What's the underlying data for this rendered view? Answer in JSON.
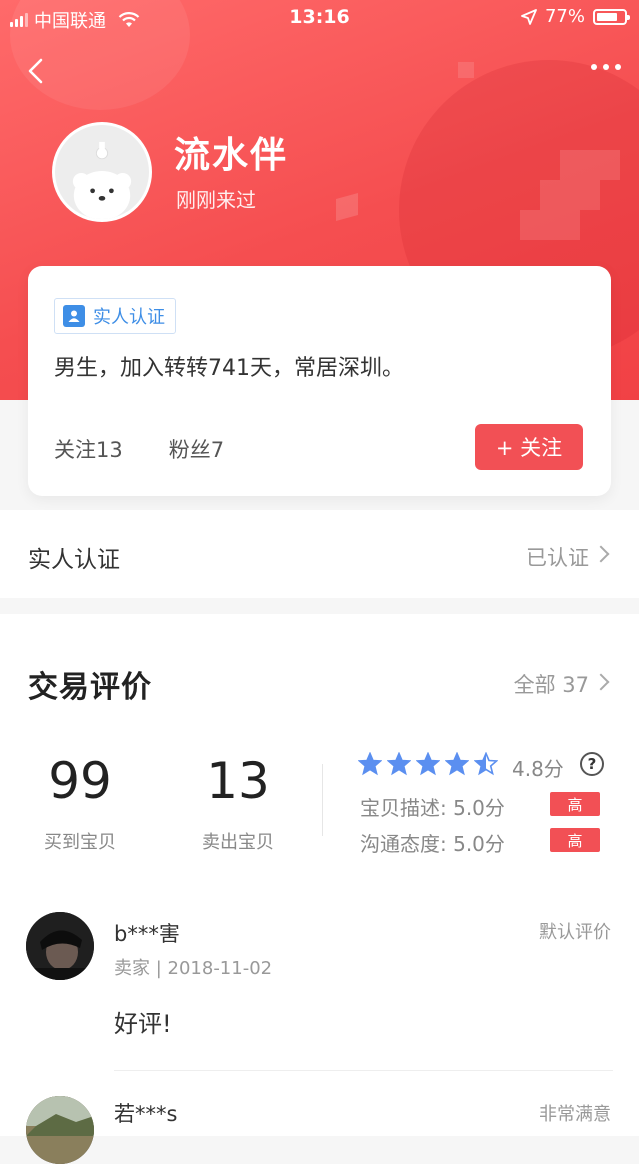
{
  "status_bar": {
    "carrier": "中国联通",
    "time": "13:16",
    "battery": "77%",
    "battery_level": 0.77
  },
  "nav": {
    "back_icon": "chevron-left-icon",
    "more_icon": "more-dots-icon"
  },
  "profile": {
    "name": "流水伴",
    "last_seen": "刚刚来过",
    "verify_tag": "实人认证",
    "description": "男生，加入转转741天，常居深圳。",
    "following": "关注13",
    "followers": "粉丝7",
    "follow_button": "+ 关注"
  },
  "verification": {
    "label": "实人认证",
    "value": "已认证"
  },
  "reviews": {
    "title": "交易评价",
    "all_link": "全部 37",
    "bought_count": "99",
    "bought_label": "买到宝贝",
    "sold_count": "13",
    "sold_label": "卖出宝贝",
    "rating_stars": 4.5,
    "rating_score": "4.8分",
    "desc_label": "宝贝描述:  5.0分",
    "desc_badge": "高",
    "comm_label": "沟通态度:  5.0分",
    "comm_badge": "高",
    "items": [
      {
        "name": "b***害",
        "type": "默认评价",
        "meta": "卖家 | 2018-11-02",
        "content": "好评!"
      },
      {
        "name": "若***s",
        "type": "非常满意"
      }
    ]
  },
  "colors": {
    "brand_red": "#f25055",
    "link_blue": "#3e8ee6",
    "star_blue": "#5b8ff0"
  }
}
